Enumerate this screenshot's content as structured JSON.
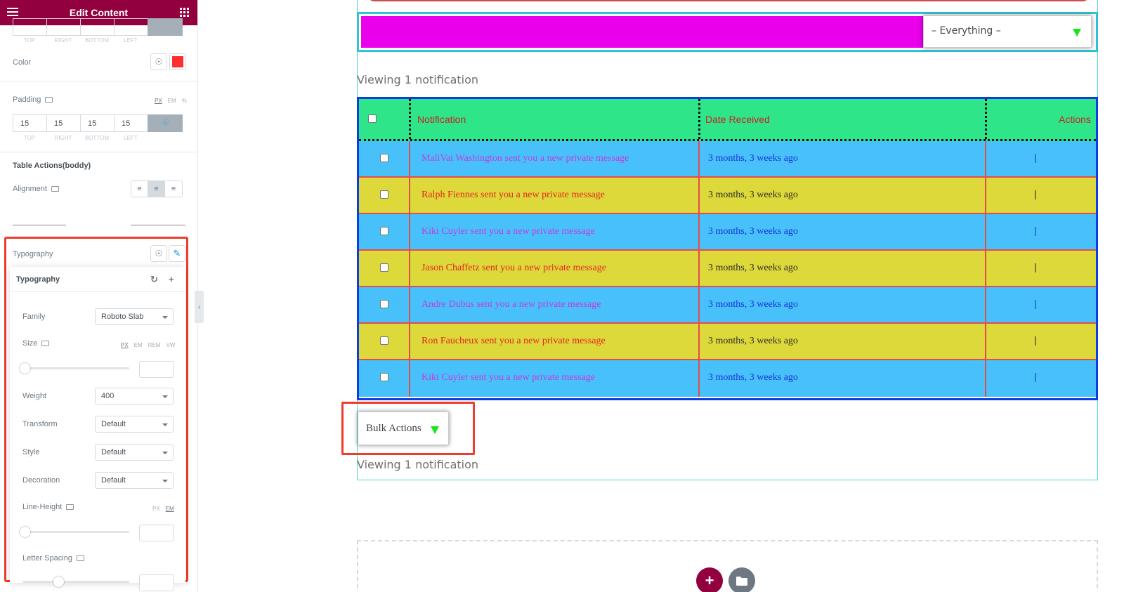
{
  "panel": {
    "title": "Edit Content",
    "top_dim_labels": [
      "TOP",
      "RIGHT",
      "BOTTOM",
      "LEFT"
    ],
    "color": {
      "label": "Color",
      "value": "#ff2d2d"
    },
    "padding": {
      "label": "Padding",
      "units": [
        "PX",
        "EM",
        "%"
      ],
      "values": [
        "15",
        "15",
        "15",
        "15"
      ],
      "dim_labels": [
        "TOP",
        "RIGHT",
        "BOTTOM",
        "LEFT"
      ]
    },
    "section_title": "Table Actions(boddy)",
    "alignment": {
      "label": "Alignment"
    },
    "typography": {
      "label": "Typography",
      "popover_title": "Typography",
      "family": {
        "label": "Family",
        "value": "Roboto Slab"
      },
      "size": {
        "label": "Size",
        "units": [
          "PX",
          "EM",
          "REM",
          "VW"
        ]
      },
      "weight": {
        "label": "Weight",
        "value": "400"
      },
      "transform": {
        "label": "Transform",
        "value": "Default"
      },
      "style": {
        "label": "Style",
        "value": "Default"
      },
      "decoration": {
        "label": "Decoration",
        "value": "Default"
      },
      "line_height": {
        "label": "Line-Height",
        "units": [
          "PX",
          "EM"
        ]
      },
      "letter_spacing": {
        "label": "Letter Spacing"
      }
    }
  },
  "preview": {
    "filter_value": "– Everything –",
    "viewing_text": "Viewing 1 notification",
    "table": {
      "headers": {
        "notification": "Notification",
        "date": "Date Received",
        "actions": "Actions"
      },
      "rows": [
        {
          "message": "MaliVai Washington sent you a new private message",
          "date": "3 months, 3 weeks ago",
          "action": "|"
        },
        {
          "message": "Ralph Fiennes sent you a new private message",
          "date": "3 months, 3 weeks ago",
          "action": "|"
        },
        {
          "message": "Kiki Cuyler sent you a new private message",
          "date": "3 months, 3 weeks ago",
          "action": "|"
        },
        {
          "message": "Jason Chaffetz sent you a new private message",
          "date": "3 months, 3 weeks ago",
          "action": "|"
        },
        {
          "message": "Andre Dubus sent you a new private message",
          "date": "3 months, 3 weeks ago",
          "action": "|"
        },
        {
          "message": "Ron Faucheux sent you a new private message",
          "date": "3 months, 3 weeks ago",
          "action": "|"
        },
        {
          "message": "Kiki Cuyler sent you a new private message",
          "date": "3 months, 3 weeks ago",
          "action": "|"
        }
      ]
    },
    "bulk_actions": "Bulk Actions"
  },
  "colors": {
    "brand": "#93003f",
    "highlight": "#ef3c2c",
    "row_blue": "#48c1fb",
    "row_yellow": "#ddd93a",
    "header_green": "#2ee58a",
    "filter_magenta": "#ea00ea"
  }
}
